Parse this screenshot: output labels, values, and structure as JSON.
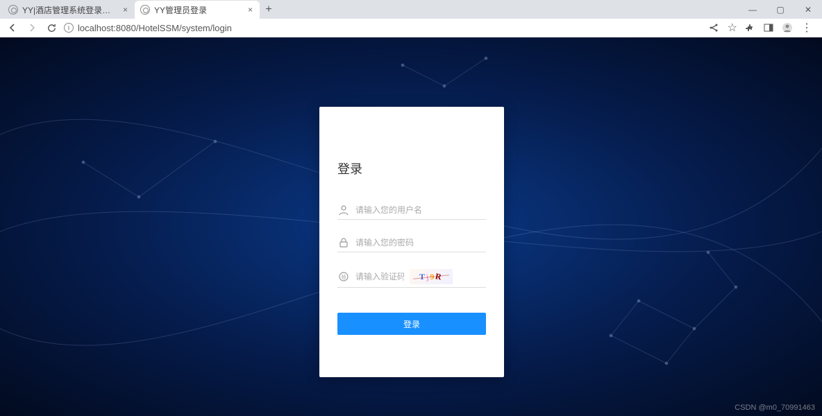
{
  "browser": {
    "tabs": [
      {
        "title": "YY|酒店管理系统登录页面",
        "active": false
      },
      {
        "title": "YY管理员登录",
        "active": true
      }
    ],
    "url": "localhost:8080/HotelSSM/system/login"
  },
  "login": {
    "title": "登录",
    "username_placeholder": "请输入您的用户名",
    "password_placeholder": "请输入您的密码",
    "captcha_placeholder": "请输入验证码",
    "captcha_chars": [
      "T",
      "j",
      "9",
      "R"
    ],
    "submit_label": "登录"
  },
  "watermark": "CSDN @m0_70991463"
}
